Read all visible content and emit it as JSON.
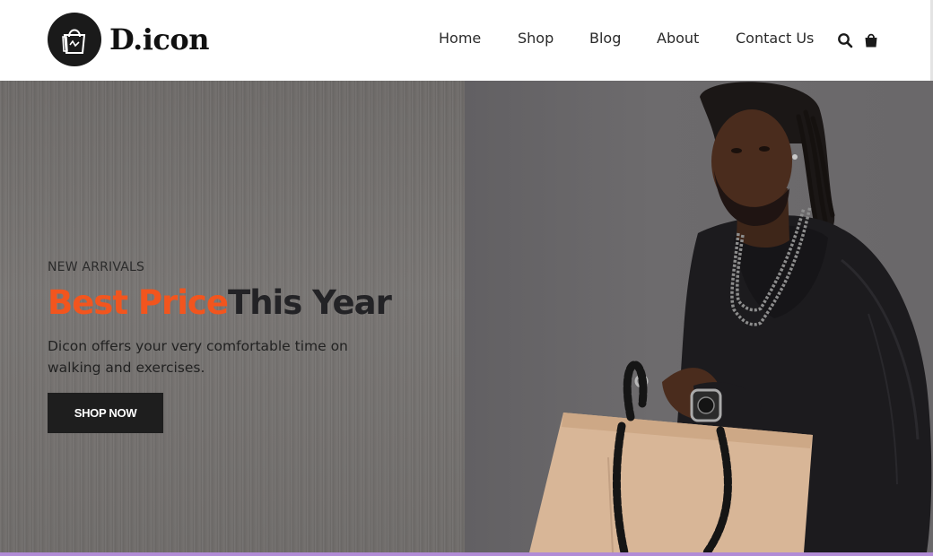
{
  "brand": {
    "name": "D.icon",
    "logo_icon": "shopping-bag-icon"
  },
  "nav": {
    "items": [
      "Home",
      "Shop",
      "Blog",
      "About",
      "Contact Us"
    ],
    "search_icon": "search-icon",
    "cart_icon": "cart-bag-icon"
  },
  "hero": {
    "kicker": "NEW ARRIVALS",
    "headline_accent": "Best Price",
    "headline_rest": "This Year",
    "description": "Dicon offers your very comfortable time on walking and exercises.",
    "cta_label": "SHOP NOW",
    "accent_color": "#f2551e",
    "image": "man-holding-paper-shopping-bag"
  }
}
